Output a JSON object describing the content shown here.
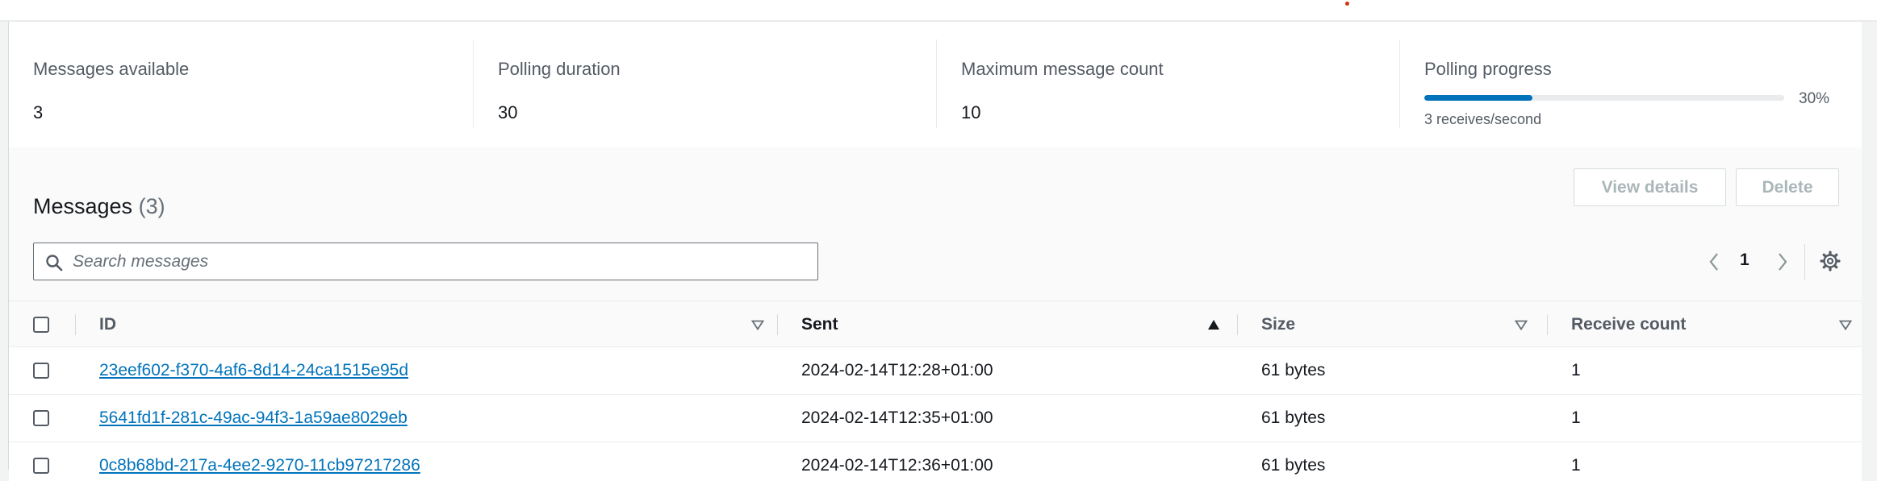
{
  "stats": [
    {
      "label": "Messages available",
      "value": "3"
    },
    {
      "label": "Polling duration",
      "value": "30"
    },
    {
      "label": "Maximum message count",
      "value": "10"
    }
  ],
  "polling": {
    "label": "Polling progress",
    "percent_label": "30%",
    "progress_fraction": 0.3,
    "rate": "3 receives/second"
  },
  "messages": {
    "title": "Messages",
    "count": "(3)",
    "view_details_label": "View details",
    "delete_label": "Delete",
    "search_placeholder": "Search messages",
    "page": "1",
    "columns": {
      "id": "ID",
      "sent": "Sent",
      "size": "Size",
      "receive_count": "Receive count"
    },
    "rows": [
      {
        "id": "23eef602-f370-4af6-8d14-24ca1515e95d",
        "sent": "2024-02-14T12:28+01:00",
        "size": "61 bytes",
        "receive_count": "1"
      },
      {
        "id": "5641fd1f-281c-49ac-94f3-1a59ae8029eb",
        "sent": "2024-02-14T12:35+01:00",
        "size": "61 bytes",
        "receive_count": "1"
      },
      {
        "id": "0c8b68bd-217a-4ee2-9270-11cb97217286",
        "sent": "2024-02-14T12:36+01:00",
        "size": "61 bytes",
        "receive_count": "1"
      }
    ]
  },
  "colors": {
    "link": "#0073bb",
    "progress": "#0073bb",
    "disabled_text": "#aab7b8"
  }
}
